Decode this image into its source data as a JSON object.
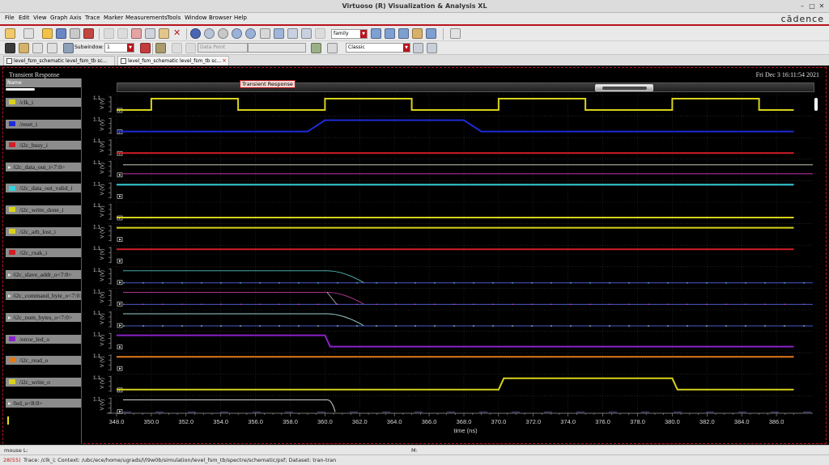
{
  "window": {
    "title": "Virtuoso (R) Visualization & Analysis XL",
    "brand": "cādence"
  },
  "menu": [
    "File",
    "Edit",
    "View",
    "Graph",
    "Axis",
    "Trace",
    "Marker",
    "Measurements",
    "Tools",
    "Window",
    "Browser",
    "Help"
  ],
  "toolbar": {
    "family_combo": "family",
    "subwindow_label": "Subwindow:",
    "subwindow_value": "1",
    "data_point_combo": "Data Point",
    "style_combo": "Classic"
  },
  "tabs": [
    {
      "label": "level_fsm_schematic level_fsm_tb sc...",
      "active": false
    },
    {
      "label": "level_fsm_schematic level_fsm_tb sc...",
      "active": true
    }
  ],
  "graph": {
    "title": "Transient Response",
    "date": "Fri Dec 3 16:11:54 2021",
    "overview_tip": "Transient Response",
    "legend_header": "Name",
    "y_tick_label": "1.1",
    "y_axis_label": "V (V)",
    "x_axis_label": "time (ns)"
  },
  "signals": [
    {
      "name": "/clk_i",
      "color": "#d8d21b"
    },
    {
      "name": "/reset_i",
      "color": "#1e2bd6"
    },
    {
      "name": "/i2c_busy_i",
      "color": "#d11e26"
    },
    {
      "name": "/i2c_data_out_i<7:0>",
      "color": "#8c8c8c",
      "bus": true
    },
    {
      "name": "/i2c_data_out_valid_i",
      "color": "#34d1dc"
    },
    {
      "name": "/i2c_write_done_i",
      "color": "#d8d21b"
    },
    {
      "name": "/i2c_arb_lost_i",
      "color": "#d8d21b"
    },
    {
      "name": "/i2c_rxak_i",
      "color": "#d11e26"
    },
    {
      "name": "/i2c_slave_addr_o<7:0>",
      "color": "#8c8c8c",
      "bus": true
    },
    {
      "name": "/i2c_command_byte_o<7:0>",
      "color": "#8c8c8c",
      "bus": true
    },
    {
      "name": "/i2c_num_bytes_o<7:0>",
      "color": "#8c8c8c",
      "bus": true
    },
    {
      "name": "/error_led_o",
      "color": "#8b22c8"
    },
    {
      "name": "/i2c_read_o",
      "color": "#e07a1c"
    },
    {
      "name": "/i2c_write_o",
      "color": "#d8d21b"
    },
    {
      "name": "/led_o<8:0>",
      "color": "#8c8c8c",
      "bus": true
    }
  ],
  "chart_data": {
    "type": "line",
    "xlabel": "time (ns)",
    "ylabel": "V (V)",
    "xlim": [
      348.0,
      387.0
    ],
    "x_ticks": [
      "348.0",
      "350.0",
      "352.0",
      "354.0",
      "356.0",
      "358.0",
      "360.0",
      "362.0",
      "364.0",
      "366.0",
      "368.0",
      "370.0",
      "372.0",
      "374.0",
      "376.0",
      "378.0",
      "380.0",
      "382.0",
      "384.0",
      "386.0"
    ],
    "series": [
      {
        "name": "/clk_i",
        "x": [
          348.0,
          350.0,
          350.0,
          355.0,
          355.0,
          360.0,
          360.0,
          365.0,
          365.0,
          370.0,
          370.0,
          375.0,
          375.0,
          380.0,
          380.0,
          385.0,
          385.0,
          387.0
        ],
        "y": [
          0,
          0,
          1.1,
          1.1,
          0,
          0,
          1.1,
          1.1,
          0,
          0,
          1.1,
          1.1,
          0,
          0,
          1.1,
          1.1,
          0,
          0
        ]
      },
      {
        "name": "/reset_i",
        "x": [
          348.0,
          359.0,
          360.0,
          368.0,
          369.0,
          387.0
        ],
        "y": [
          0,
          0,
          1.1,
          1.1,
          0,
          0
        ]
      },
      {
        "name": "/i2c_busy_i",
        "x": [
          348.0,
          387.0
        ],
        "y": [
          0,
          0
        ]
      },
      {
        "name": "/i2c_data_out_valid_i",
        "x": [
          348.0,
          387.0
        ],
        "y": [
          1.1,
          1.1
        ]
      },
      {
        "name": "/i2c_write_done_i",
        "x": [
          348.0,
          387.0
        ],
        "y": [
          0,
          0
        ]
      },
      {
        "name": "/i2c_arb_lost_i",
        "x": [
          348.0,
          387.0
        ],
        "y": [
          1.1,
          1.1
        ]
      },
      {
        "name": "/i2c_rxak_i",
        "x": [
          348.0,
          387.0
        ],
        "y": [
          1.1,
          1.1
        ]
      },
      {
        "name": "/error_led_o",
        "x": [
          348.0,
          360.0,
          360.3,
          387.0
        ],
        "y": [
          1.1,
          1.1,
          0,
          0
        ]
      },
      {
        "name": "/i2c_read_o",
        "x": [
          348.0,
          387.0
        ],
        "y": [
          1.1,
          1.1
        ]
      },
      {
        "name": "/i2c_write_o",
        "x": [
          348.0,
          370.0,
          370.3,
          380.0,
          380.3,
          387.0
        ],
        "y": [
          0,
          0,
          1.1,
          1.1,
          0,
          0
        ]
      }
    ]
  },
  "status": {
    "mouse_left": "mouse L:",
    "mouse_mid": "M:",
    "count": "28(55)",
    "context": "Trace: /clk_i; Context: /ubc/ece/home/ugrads/l/l9w0b/simulation/level_fsm_tb/spectre/schematic/psf; Dataset: tran-tran"
  }
}
